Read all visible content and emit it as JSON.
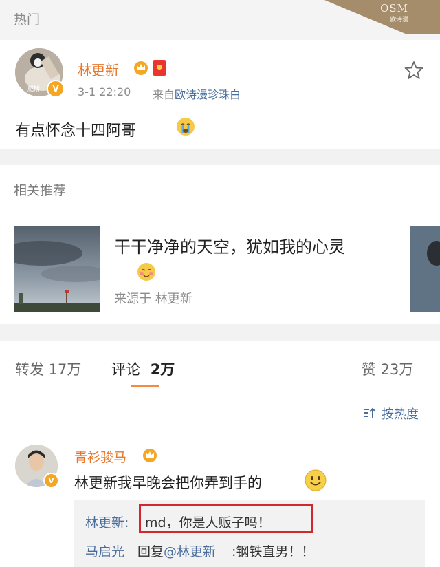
{
  "hot_section": {
    "title": "热门"
  },
  "osm_badge": {
    "brand": "OSM",
    "subtitle": "欧诗漫"
  },
  "post": {
    "username": "林更新",
    "avatar_text": "威斯",
    "time": "3-1 22:20",
    "source_prefix": "来自",
    "source": "欧诗漫珍珠白",
    "text": "有点怀念十四阿哥",
    "icons": [
      "crown-icon",
      "hongbao-icon",
      "star-icon",
      "crying-emoji"
    ]
  },
  "related": {
    "title": "相关推荐",
    "card_text": "干干净净的天空，犹如我的心灵",
    "card_source": "来源于 林更新"
  },
  "stats": {
    "repost": "转发 17万",
    "comment_label": "评论",
    "comment_count": "2万",
    "like": "赞 23万"
  },
  "sort": {
    "label": "按热度"
  },
  "comment": {
    "username": "青衫骏马",
    "text": "林更新我早晚会把你弄到手的",
    "replies": [
      {
        "name": "林更新:",
        "text": "md，你是人贩子吗！"
      },
      {
        "name": "马启光",
        "reply_word": "回复",
        "mention": "@林更新",
        "text": ":钢铁直男！！"
      }
    ]
  },
  "colors": {
    "orange_name": "#e8762b",
    "link_blue": "#4a6e9c",
    "highlight_red": "#d0282b",
    "tab_orange": "#f38a3c"
  }
}
